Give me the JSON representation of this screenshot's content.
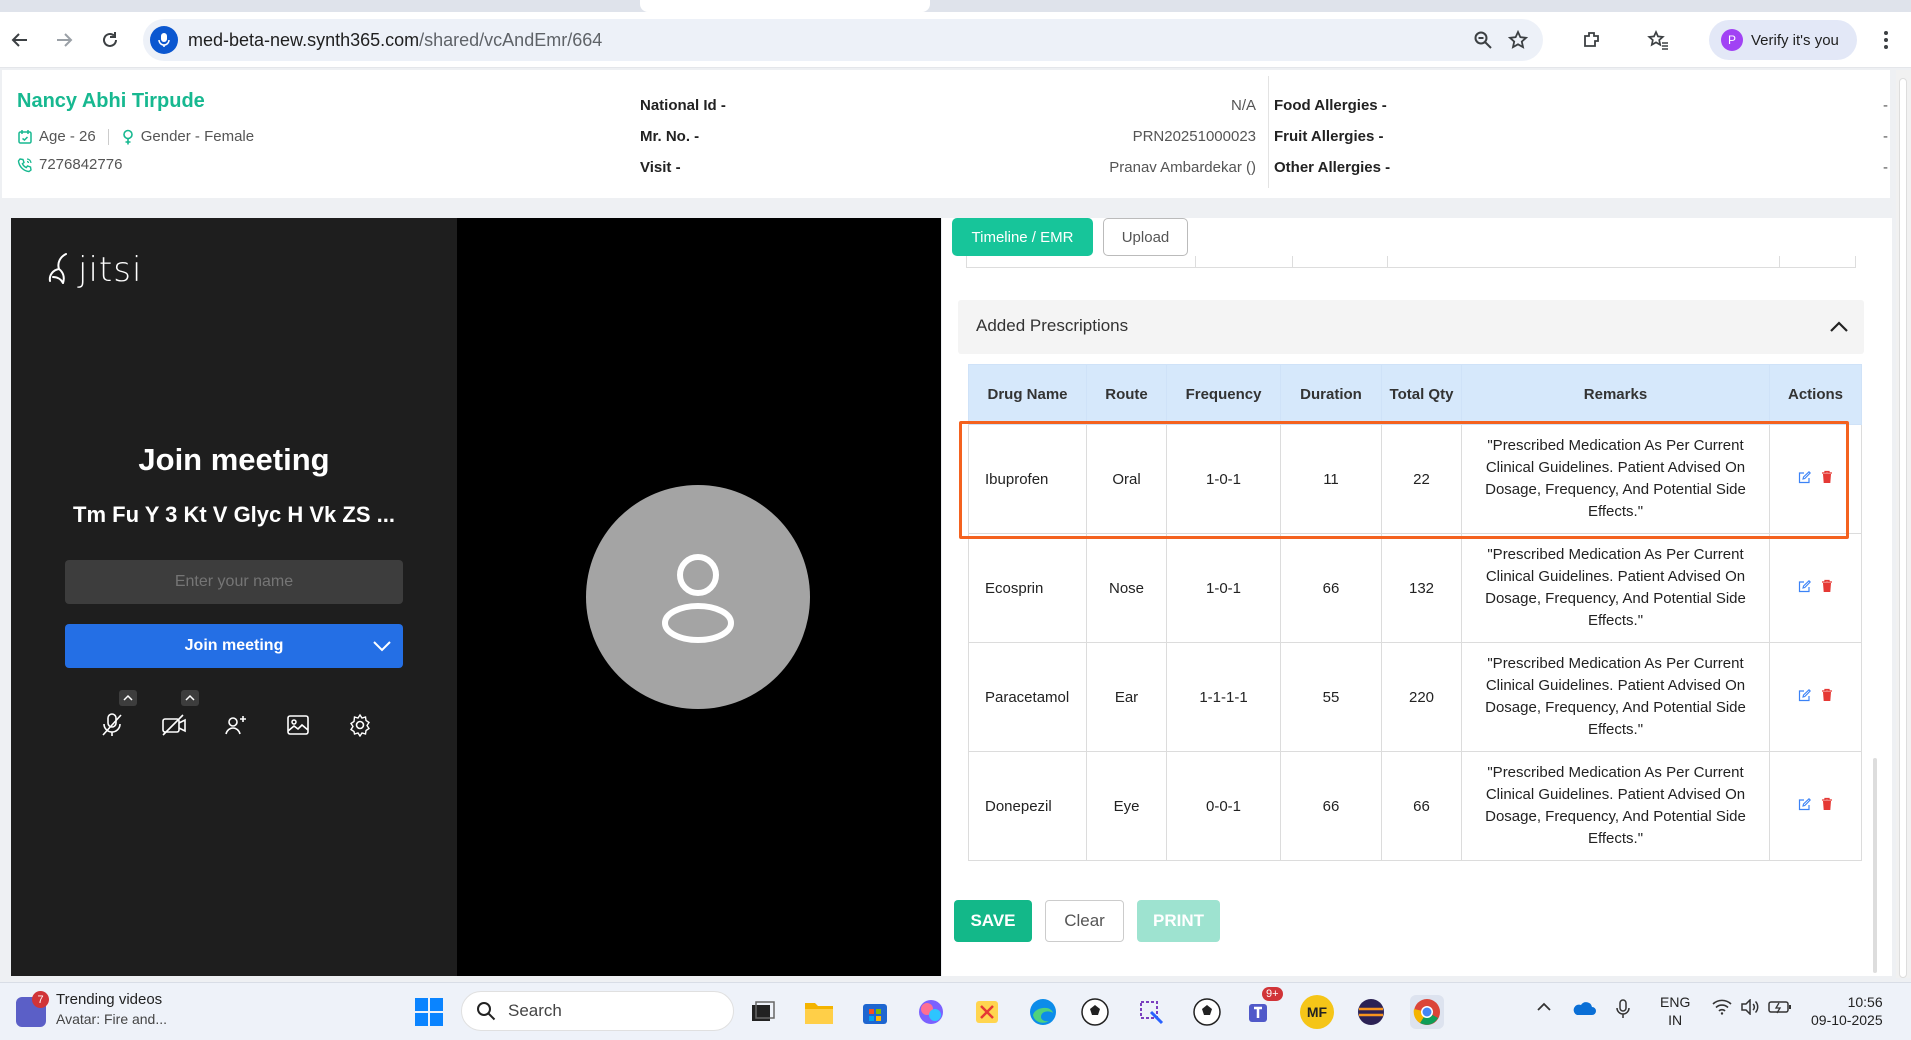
{
  "browser": {
    "url_host": "med-beta-new.synth365.com",
    "url_path": "/shared/vcAndEmr/664",
    "verify_label": "Verify it's you",
    "profile_initial": "P"
  },
  "patient": {
    "name": "Nancy Abhi Tirpude",
    "age": "Age - 26",
    "gender": "Gender - Female",
    "phone": "7276842776",
    "national_id_label": "National Id -",
    "national_id_value": "N/A",
    "mr_no_label": "Mr. No. -",
    "mr_no_value": "PRN20251000023",
    "visit_label": "Visit -",
    "visit_value": "Pranav Ambardekar ()",
    "food_allergies_label": "Food Allergies -",
    "food_allergies_value": "-",
    "fruit_allergies_label": "Fruit Allergies -",
    "fruit_allergies_value": "-",
    "other_allergies_label": "Other Allergies -",
    "other_allergies_value": "-"
  },
  "jitsi": {
    "logo": "jitsi",
    "title": "Join meeting",
    "room_name": "Tm Fu Y 3 Kt V Glyc H Vk ZS ...",
    "name_placeholder": "Enter your name",
    "join_label": "Join meeting",
    "toolbar_icons": [
      "mic-off-icon",
      "camera-off-icon",
      "invite-icon",
      "background-icon",
      "settings-icon"
    ]
  },
  "emr": {
    "tabs": [
      "Timeline / EMR",
      "Upload"
    ],
    "section_title": "Added Prescriptions",
    "columns": [
      "Drug Name",
      "Route",
      "Frequency",
      "Duration",
      "Total Qty",
      "Remarks",
      "Actions"
    ],
    "rows": [
      {
        "drug": "Ibuprofen",
        "route": "Oral",
        "frequency": "1-0-1",
        "duration": "11",
        "total_qty": "22",
        "remarks": "\"Prescribed Medication As Per Current Clinical Guidelines. Patient Advised On Dosage, Frequency, And Potential Side Effects.\""
      },
      {
        "drug": "Ecosprin",
        "route": "Nose",
        "frequency": "1-0-1",
        "duration": "66",
        "total_qty": "132",
        "remarks": "\"Prescribed Medication As Per Current Clinical Guidelines. Patient Advised On Dosage, Frequency, And Potential Side Effects.\""
      },
      {
        "drug": "Paracetamol",
        "route": "Ear",
        "frequency": "1-1-1-1",
        "duration": "55",
        "total_qty": "220",
        "remarks": "\"Prescribed Medication As Per Current Clinical Guidelines. Patient Advised On Dosage, Frequency, And Potential Side Effects.\""
      },
      {
        "drug": "Donepezil",
        "route": "Eye",
        "frequency": "0-0-1",
        "duration": "66",
        "total_qty": "66",
        "remarks": "\"Prescribed Medication As Per Current Clinical Guidelines. Patient Advised On Dosage, Frequency, And Potential Side Effects.\""
      }
    ],
    "save_label": "SAVE",
    "clear_label": "Clear",
    "print_label": "PRINT"
  },
  "taskbar": {
    "widget_title": "Trending videos",
    "widget_subtitle": "Avatar: Fire and...",
    "widget_badge": "7",
    "search_label": "Search",
    "teams_badge": "9+",
    "mf_label": "MF",
    "lang_line1": "ENG",
    "lang_line2": "IN",
    "time": "10:56",
    "date": "09-10-2025"
  },
  "colors": {
    "accent": "#17b890",
    "jitsi_blue": "#246fe5",
    "highlight": "#f4621f",
    "table_header": "#d6e8fb"
  }
}
